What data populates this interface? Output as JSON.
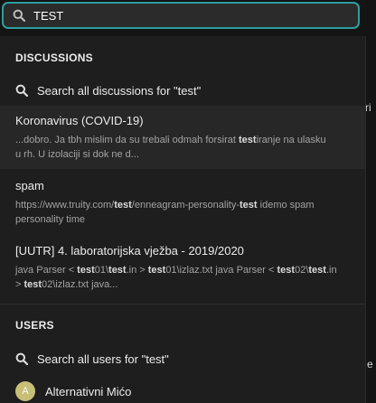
{
  "search": {
    "value": "TEST"
  },
  "discussions": {
    "header": "DISCUSSIONS",
    "search_all_label": "Search all discussions for \"test\"",
    "results": [
      {
        "title": "Koronavirus (COVID-19)",
        "snippet_line1": [
          "...dobro. Ja tbh mislim da su trebali odmah forsirat ",
          "test",
          "iranje na ulasku"
        ],
        "snippet_line2": "u rh. U izolaciji si dok ne d..."
      },
      {
        "title": "spam",
        "snippet_line1": [
          "https://www.truity.com/",
          "test",
          "/enneagram-personality-",
          "test",
          " idemo spam"
        ],
        "snippet_line2": "personality time"
      },
      {
        "title": "[UUTR] 4. laboratorijska vježba - 2019/2020",
        "snippet_line1": [
          "java Parser < ",
          "test",
          "01\\",
          "test",
          ".in > ",
          "test",
          "01\\izlaz.txt java Parser < ",
          "test",
          "02\\",
          "test",
          ".in"
        ],
        "snippet_line2": [
          "> ",
          "test",
          "02\\izlaz.txt java..."
        ]
      }
    ]
  },
  "users": {
    "header": "USERS",
    "search_all_label": "Search all users for \"test\"",
    "results": [
      {
        "initial": "A",
        "name": "Alternativni Mićo",
        "avatar_color": "#c9be78"
      }
    ]
  },
  "backdrop": {
    "right_chars": [
      "ri",
      "e"
    ]
  },
  "colors": {
    "accent": "#2e9e9e",
    "panel": "#1e1e1e",
    "input_bg": "#2b2b2b"
  }
}
